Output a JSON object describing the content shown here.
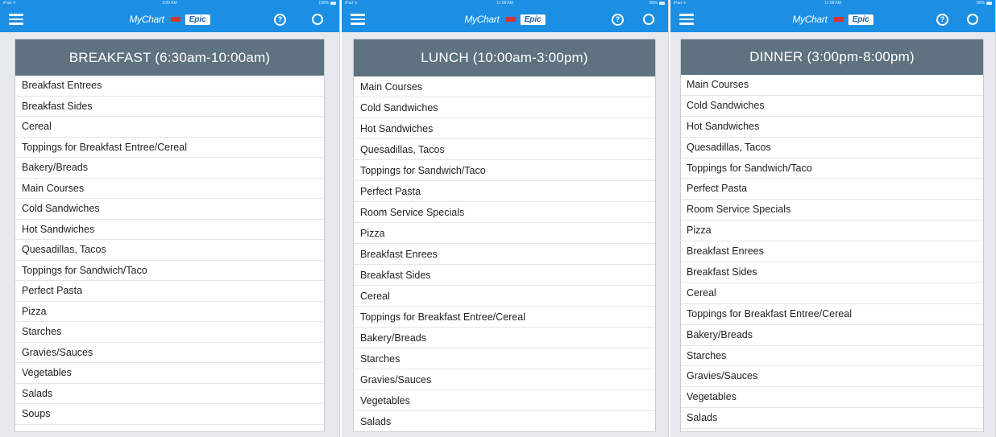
{
  "screens": [
    {
      "status": {
        "left": "iPad ᯤ",
        "time": "9:00 AM",
        "right": "100%"
      },
      "app": {
        "logo_text": "MyChart",
        "epic_label": "Epic",
        "help_glyph": "?"
      },
      "meal": {
        "title": "BREAKFAST (6:30am-10:00am)",
        "items": [
          "Breakfast Entrees",
          "Breakfast Sides",
          "Cereal",
          "Toppings for Breakfast Entree/Cereal",
          "Bakery/Breads",
          "Main Courses",
          "Cold Sandwiches",
          "Hot Sandwiches",
          "Quesadillas, Tacos",
          "Toppings for Sandwich/Taco",
          "Perfect Pasta",
          "Pizza",
          "Starches",
          "Gravies/Sauces",
          "Vegetables",
          "Salads",
          "Soups"
        ]
      }
    },
    {
      "status": {
        "left": "iPad ᯤ",
        "time": "11:08 AM",
        "right": "86%"
      },
      "app": {
        "logo_text": "MyChart",
        "epic_label": "Epic",
        "help_glyph": "?"
      },
      "meal": {
        "title": "LUNCH (10:00am-3:00pm)",
        "items": [
          "Main Courses",
          "Cold Sandwiches",
          "Hot Sandwiches",
          "Quesadillas, Tacos",
          "Toppings for Sandwich/Taco",
          "Perfect Pasta",
          "Room Service Specials",
          "Pizza",
          "Breakfast Enrees",
          "Breakfast Sides",
          "Cereal",
          "Toppings for Breakfast Entree/Cereal",
          "Bakery/Breads",
          "Starches",
          "Gravies/Sauces",
          "Vegetables",
          "Salads"
        ]
      }
    },
    {
      "status": {
        "left": "iPad ᯤ",
        "time": "11:08 AM",
        "right": "86%"
      },
      "app": {
        "logo_text": "MyChart",
        "epic_label": "Epic",
        "help_glyph": "?"
      },
      "meal": {
        "title": "DINNER (3:00pm-8:00pm)",
        "items": [
          "Main Courses",
          "Cold Sandwiches",
          "Hot Sandwiches",
          "Quesadillas, Tacos",
          "Toppings for Sandwich/Taco",
          "Perfect Pasta",
          "Room Service Specials",
          "Pizza",
          "Breakfast Enrees",
          "Breakfast Sides",
          "Cereal",
          "Toppings for Breakfast Entree/Cereal",
          "Bakery/Breads",
          "Starches",
          "Gravies/Sauces",
          "Vegetables",
          "Salads"
        ]
      }
    }
  ],
  "colors": {
    "nav_blue": "#1b8fe3",
    "header_slate": "#5e7280"
  },
  "icons": {
    "menu": "hamburger-menu-icon",
    "help": "help-icon",
    "refresh": "refresh-icon"
  }
}
